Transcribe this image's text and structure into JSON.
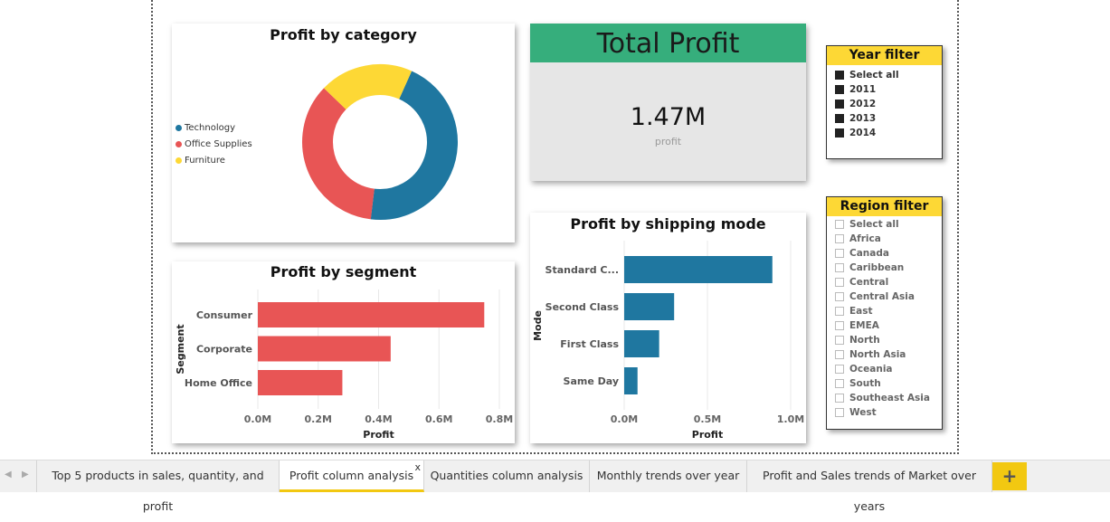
{
  "report": {
    "profit_by_category": {
      "title": "Profit by category",
      "legend": [
        {
          "label": "Technology",
          "color": "#1f77a0"
        },
        {
          "label": "Office Supplies",
          "color": "#e85555"
        },
        {
          "label": "Furniture",
          "color": "#fdd835"
        }
      ]
    },
    "total_profit": {
      "header": "Total Profit",
      "value": "1.47M",
      "label": "profit",
      "header_color": "#36ae7c"
    },
    "year_filter": {
      "title": "Year filter",
      "items": [
        "Select all",
        "2011",
        "2012",
        "2013",
        "2014"
      ]
    },
    "region_filter": {
      "title": "Region filter",
      "items": [
        "Select all",
        "Africa",
        "Canada",
        "Caribbean",
        "Central",
        "Central Asia",
        "East",
        "EMEA",
        "North",
        "North Asia",
        "Oceania",
        "South",
        "Southeast Asia",
        "West"
      ]
    },
    "profit_by_segment": {
      "title": "Profit by segment",
      "ylabel": "Segment",
      "xlabel": "Profit",
      "color": "#e85555"
    },
    "profit_by_shipping": {
      "title": "Profit by shipping mode",
      "ylabel": "Mode",
      "xlabel": "Profit",
      "color": "#1f77a0"
    }
  },
  "chart_data": [
    {
      "type": "pie",
      "title": "Profit by category",
      "categories": [
        "Technology",
        "Office Supplies",
        "Furniture"
      ],
      "values": [
        0.663,
        0.518,
        0.286
      ],
      "colors": [
        "#1f77a0",
        "#e85555",
        "#fdd835"
      ]
    },
    {
      "type": "bar",
      "title": "Profit by segment",
      "categories": [
        "Consumer",
        "Corporate",
        "Home Office"
      ],
      "values": [
        0.75,
        0.44,
        0.28
      ],
      "xlabel": "Profit",
      "ylabel": "Segment",
      "xlim": [
        0,
        0.8
      ],
      "ticks": [
        "0.0M",
        "0.2M",
        "0.4M",
        "0.6M",
        "0.8M"
      ]
    },
    {
      "type": "bar",
      "title": "Profit by shipping mode",
      "categories": [
        "Standard C...",
        "Second Class",
        "First Class",
        "Same Day"
      ],
      "values": [
        0.89,
        0.3,
        0.21,
        0.08
      ],
      "xlabel": "Profit",
      "ylabel": "Mode",
      "xlim": [
        0,
        1.0
      ],
      "ticks": [
        "0.0M",
        "0.5M",
        "1.0M"
      ]
    }
  ],
  "tabs": {
    "items": [
      {
        "label": "Top 5 products in sales, quantity, and profit"
      },
      {
        "label": "Profit column analysis",
        "active": true
      },
      {
        "label": "Quantities column analysis"
      },
      {
        "label": "Monthly trends over year"
      },
      {
        "label": "Profit and Sales trends of Market over years"
      }
    ],
    "add_label": "+",
    "close_label": "x",
    "prev_label": "◀",
    "next_label": "▶"
  }
}
